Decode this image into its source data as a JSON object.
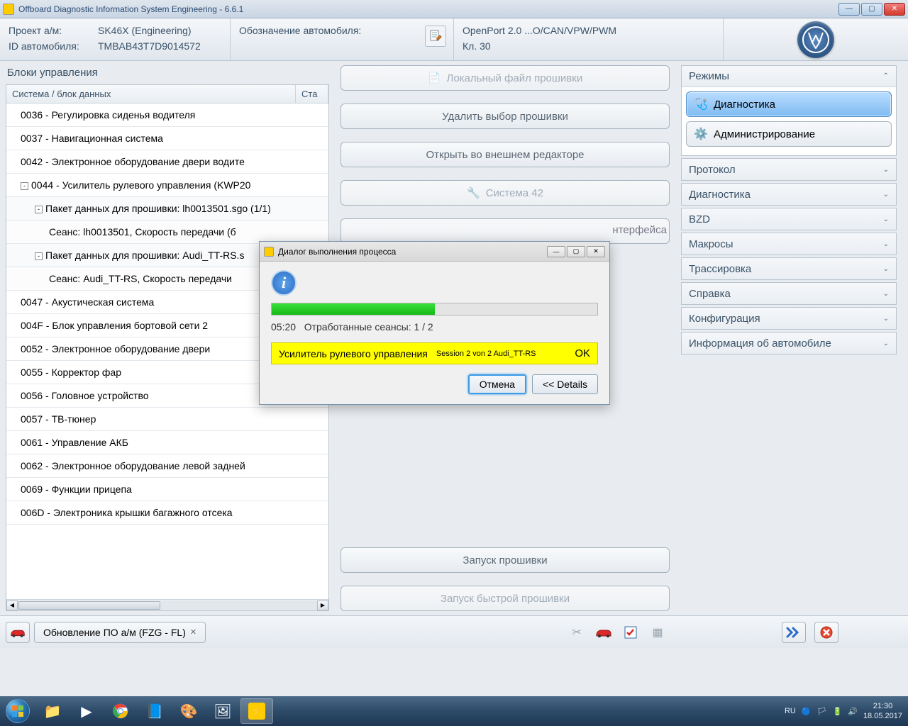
{
  "window": {
    "title": "Offboard Diagnostic Information System Engineering - 6.6.1",
    "min": "—",
    "max": "▢",
    "close": "✕"
  },
  "header": {
    "project_label": "Проект а/м:",
    "project_value": "SK46X    (Engineering)",
    "id_label": "ID автомобиля:",
    "id_value": "TMBAB43T7D9014572",
    "vehicle_label": "Обозначение автомобиля:",
    "interface_line1": "OpenPort 2.0 ...O/CAN/VPW/PWM",
    "interface_line2": "Кл. 30"
  },
  "left": {
    "title": "Блоки управления",
    "col1": "Система / блок данных",
    "col2": "Ста",
    "rows": [
      {
        "lvl": 0,
        "text": "0036 - Регулировка сиденья водителя"
      },
      {
        "lvl": 0,
        "text": "0037 - Навигационная система"
      },
      {
        "lvl": 0,
        "text": "0042 - Электронное оборудование двери водите"
      },
      {
        "lvl": 0,
        "toggle": "-",
        "text": "0044 - Усилитель рулевого управления  (KWP20"
      },
      {
        "lvl": 1,
        "toggle": "-",
        "text": "Пакет данных для прошивки: lh0013501.sgo (1/1)"
      },
      {
        "lvl": 2,
        "text": "Сеанс: lh0013501, Скорость передачи (б"
      },
      {
        "lvl": 1,
        "toggle": "-",
        "text": "Пакет данных для прошивки: Audi_TT-RS.s"
      },
      {
        "lvl": 2,
        "text": "Сеанс: Audi_TT-RS, Скорость передачи"
      },
      {
        "lvl": 0,
        "text": "0047 - Акустическая система"
      },
      {
        "lvl": 0,
        "text": "004F - Блок управления бортовой сети 2"
      },
      {
        "lvl": 0,
        "text": "0052 - Электронное оборудование двери"
      },
      {
        "lvl": 0,
        "text": "0055 - Корректор фар"
      },
      {
        "lvl": 0,
        "text": "0056 - Головное устройство"
      },
      {
        "lvl": 0,
        "text": "0057 - ТВ-тюнер"
      },
      {
        "lvl": 0,
        "text": "0061 - Управление АКБ"
      },
      {
        "lvl": 0,
        "text": "0062 - Электронное оборудование левой задней"
      },
      {
        "lvl": 0,
        "text": "0069 - Функции прицепа"
      },
      {
        "lvl": 0,
        "text": "006D - Электроника крышки багажного отсека"
      }
    ]
  },
  "mid": {
    "btn_local": "Локальный файл прошивки",
    "btn_delete": "Удалить выбор прошивки",
    "btn_open": "Открыть во внешнем редакторе",
    "btn_system42": "Система 42",
    "hidden1": "нтерфейса",
    "btn_flash": "Запуск прошивки",
    "btn_fastflash": "Запуск быстрой прошивки"
  },
  "right": {
    "modes_title": "Режимы",
    "mode_diag": "Диагностика",
    "mode_admin": "Администрирование",
    "sections": [
      "Протокол",
      "Диагностика",
      "BZD",
      "Макросы",
      "Трассировка",
      "Справка",
      "Конфигурация",
      "Информация об автомобиле"
    ]
  },
  "bottom": {
    "tab_label": "Обновление ПО а/м (FZG - FL)",
    "tab_close": "✕"
  },
  "dialog": {
    "title": "Диалог выполнения процесса",
    "progress_text_time": "05:20",
    "progress_text_label": "Отработанные сеансы: 1 / 2",
    "status_main": "Усилитель рулевого управления",
    "status_sub": "Session 2 von 2   Audi_TT-RS",
    "status_ok": "OK",
    "btn_cancel": "Отмена",
    "btn_details": "<<  Details"
  },
  "taskbar": {
    "lang": "RU",
    "time": "21:30",
    "date": "18.05.2017"
  }
}
